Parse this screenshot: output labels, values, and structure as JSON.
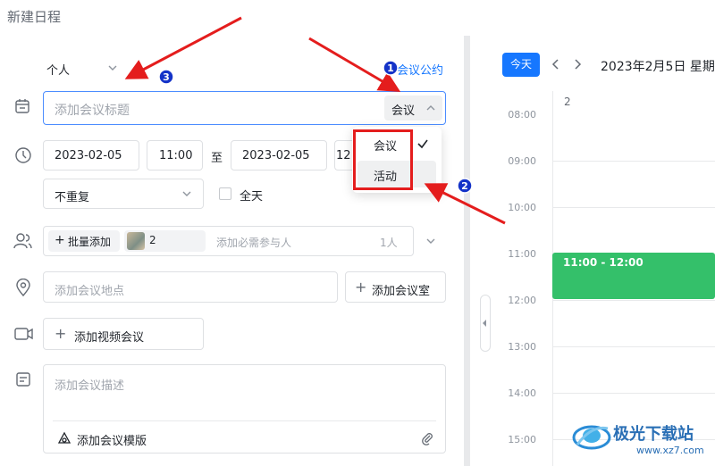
{
  "window": {
    "title": "新建日程"
  },
  "form": {
    "calendar_select": "个人",
    "meeting_convention": "会议公约",
    "title_placeholder": "添加会议标题",
    "type_select": "会议",
    "start_date": "2023-02-05",
    "start_time": "11:00",
    "to_label": "至",
    "end_date": "2023-02-05",
    "end_time_partial": "12",
    "repeat_select": "不重复",
    "allday_label": "全天",
    "batch_add": "批量添加",
    "attendee_count": "2",
    "attendee_placeholder": "添加必需参与人",
    "attendee_people": "1人",
    "location_placeholder": "添加会议地点",
    "add_room": "添加会议室",
    "add_video": "添加视频会议",
    "desc_placeholder": "添加会议描述",
    "add_template": "添加会议模版"
  },
  "dropdown": {
    "options": [
      "会议",
      "活动"
    ],
    "selected": "会议"
  },
  "annotations": {
    "marker1": "1",
    "marker2": "2",
    "marker3": "3"
  },
  "calendar": {
    "today_button": "今天",
    "date_title": "2023年2月5日 星期",
    "day_label": "2",
    "hours": [
      "08:00",
      "09:00",
      "10:00",
      "11:00",
      "12:00",
      "13:00",
      "14:00",
      "15:00"
    ],
    "event": {
      "label": "11:00 - 12:00",
      "color": "#34c06a"
    }
  },
  "watermark": {
    "text": "极光下载站",
    "url": "www.xz7.com"
  },
  "colors": {
    "accent": "#1677ff",
    "annotation_red": "#e41d1d",
    "marker_blue": "#1433c8"
  }
}
